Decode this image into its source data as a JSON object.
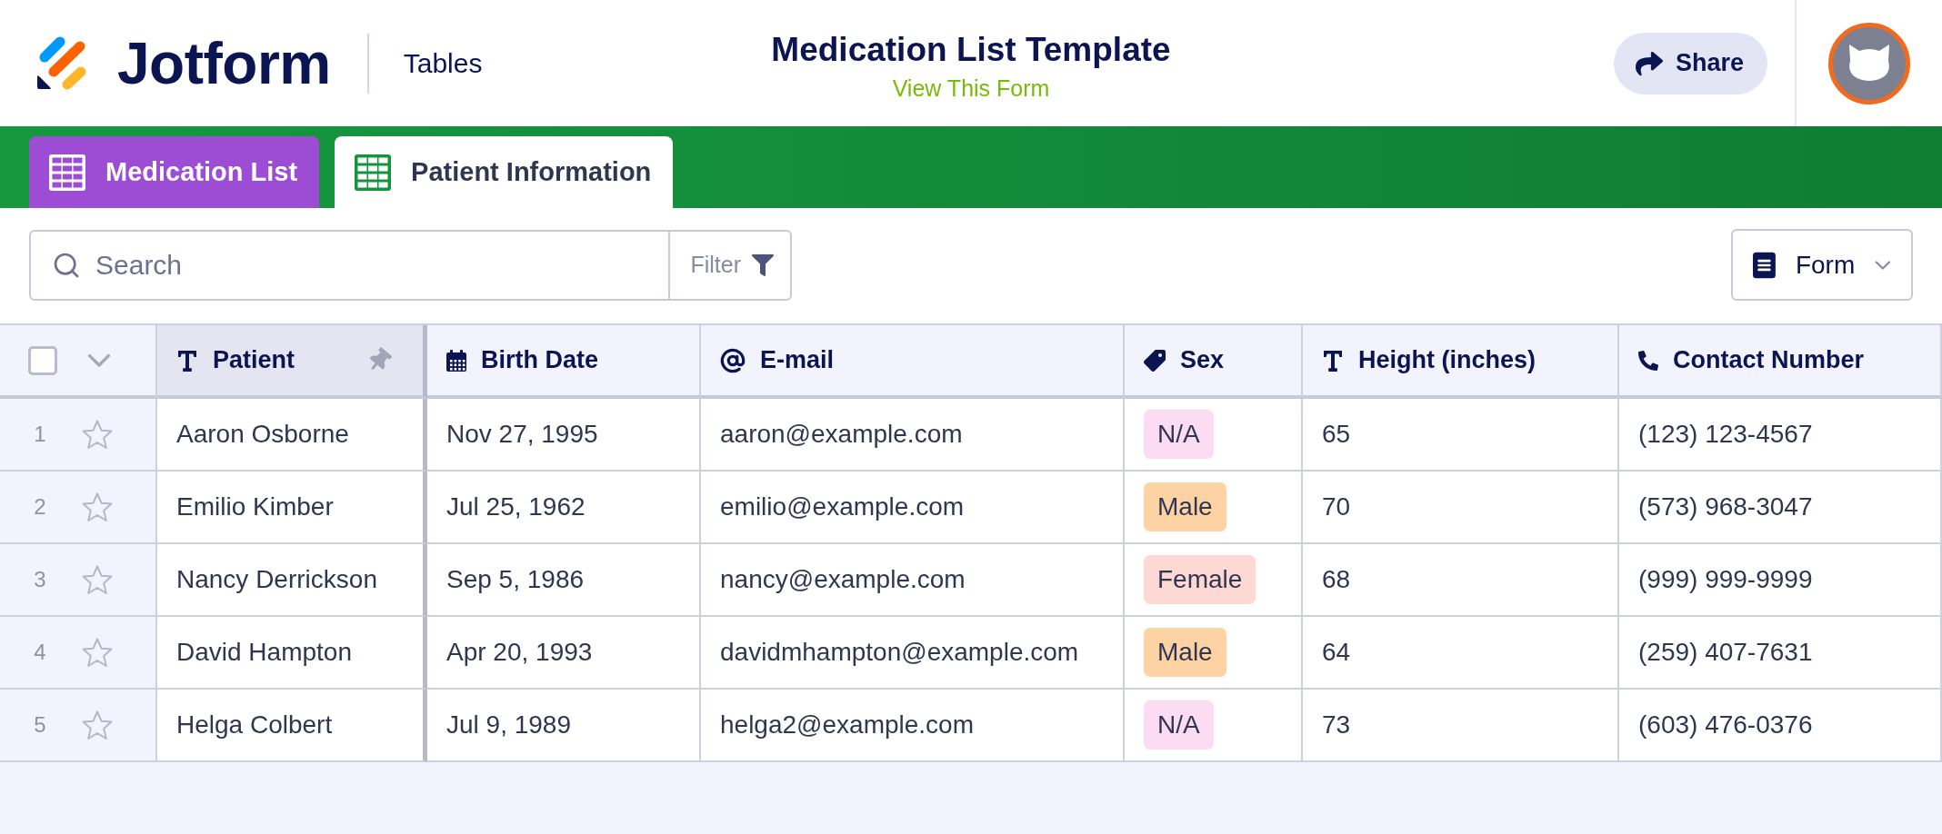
{
  "header": {
    "brand": "Jotform",
    "product": "Tables",
    "title": "Medication List Template",
    "view_link": "View This Form",
    "share_button": "Share"
  },
  "tabs": [
    {
      "label": "Medication List",
      "selected": false,
      "color": "#9c4dd3"
    },
    {
      "label": "Patient Information",
      "selected": true,
      "color": "#12963c"
    }
  ],
  "toolbar": {
    "search": {
      "placeholder": "Search"
    },
    "filter_button": "Filter",
    "view_button": "Form"
  },
  "table": {
    "select_all": {
      "checked": false
    },
    "columns": [
      {
        "label": "Patient",
        "kind": "text",
        "pinned": true
      },
      {
        "label": "Birth Date",
        "kind": "date",
        "pinned": false
      },
      {
        "label": "E-mail",
        "kind": "email",
        "pinned": false
      },
      {
        "label": "Sex",
        "kind": "tag",
        "pinned": false
      },
      {
        "label": "Height (inches)",
        "kind": "text",
        "pinned": false
      },
      {
        "label": "Contact Number",
        "kind": "phone",
        "pinned": false
      }
    ],
    "rows": [
      {
        "number": "1",
        "starred": false,
        "cells": [
          {
            "text": "Aaron Osborne"
          },
          {
            "text": "Nov 27, 1995"
          },
          {
            "text": "aaron@example.com"
          },
          {
            "text": "N/A",
            "color": "#fcdcf2"
          },
          {
            "text": "65"
          },
          {
            "text": "(123) 123-4567"
          }
        ]
      },
      {
        "number": "2",
        "starred": false,
        "cells": [
          {
            "text": "Emilio Kimber"
          },
          {
            "text": "Jul 25, 1962"
          },
          {
            "text": "emilio@example.com"
          },
          {
            "text": "Male",
            "color": "#fdd3a3"
          },
          {
            "text": "70"
          },
          {
            "text": "(573) 968-3047"
          }
        ]
      },
      {
        "number": "3",
        "starred": false,
        "cells": [
          {
            "text": "Nancy Derrickson"
          },
          {
            "text": "Sep 5, 1986"
          },
          {
            "text": "nancy@example.com"
          },
          {
            "text": "Female",
            "color": "#fed9d3"
          },
          {
            "text": "68"
          },
          {
            "text": "(999) 999-9999"
          }
        ]
      },
      {
        "number": "4",
        "starred": false,
        "cells": [
          {
            "text": "David Hampton"
          },
          {
            "text": "Apr 20, 1993"
          },
          {
            "text": "davidmhampton@example.com"
          },
          {
            "text": "Male",
            "color": "#fdd3a3"
          },
          {
            "text": "64"
          },
          {
            "text": "(259) 407-7631"
          }
        ]
      },
      {
        "number": "5",
        "starred": false,
        "cells": [
          {
            "text": "Helga Colbert"
          },
          {
            "text": "Jul 9, 1989"
          },
          {
            "text": "helga2@example.com"
          },
          {
            "text": "N/A",
            "color": "#fcdcf2"
          },
          {
            "text": "73"
          },
          {
            "text": "(603) 476-0376"
          }
        ]
      }
    ]
  }
}
